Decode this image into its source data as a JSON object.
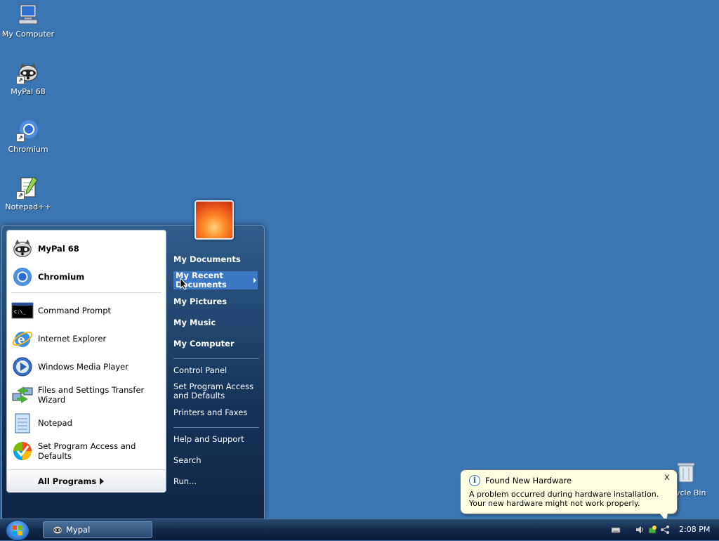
{
  "desktop": {
    "icons": [
      {
        "label": "My Computer",
        "icon": "my-computer-icon"
      },
      {
        "label": "MyPal 68",
        "icon": "mypal-icon"
      },
      {
        "label": "Chromium",
        "icon": "chromium-icon"
      },
      {
        "label": "Notepad++",
        "icon": "notepad-plus-plus-icon"
      }
    ],
    "recycle_bin_label": "ycle Bin"
  },
  "start_menu": {
    "pinned": [
      {
        "label": "MyPal 68",
        "icon": "mypal-icon"
      },
      {
        "label": "Chromium",
        "icon": "chromium-icon"
      }
    ],
    "recent": [
      {
        "label": "Command Prompt",
        "icon": "command-prompt-icon"
      },
      {
        "label": "Internet Explorer",
        "icon": "internet-explorer-icon"
      },
      {
        "label": "Windows Media Player",
        "icon": "windows-media-player-icon"
      },
      {
        "label": "Files and Settings Transfer Wizard",
        "icon": "transfer-wizard-icon"
      },
      {
        "label": "Notepad",
        "icon": "notepad-icon"
      },
      {
        "label": "Set Program Access and Defaults",
        "icon": "program-defaults-icon"
      }
    ],
    "all_programs": "All Programs",
    "right": {
      "my_documents": "My Documents",
      "my_recent_documents_1": "My Recent",
      "my_recent_documents_2": "Documents",
      "my_pictures": "My Pictures",
      "my_music": "My Music",
      "my_computer": "My Computer",
      "control_panel": "Control Panel",
      "set_program_access_1": "Set Program Access",
      "set_program_access_2": "and Defaults",
      "printers_and_faxes": "Printers and Faxes",
      "help_and_support": "Help and Support",
      "search": "Search",
      "run": "Run..."
    }
  },
  "taskbar": {
    "tasks": [
      {
        "label": "Mypal",
        "icon": "mypal-icon"
      }
    ],
    "clock": "2:08 PM"
  },
  "balloon": {
    "title": "Found New Hardware",
    "message": "A problem occurred during hardware installation. Your new hardware might not work properly.",
    "close": "x"
  }
}
